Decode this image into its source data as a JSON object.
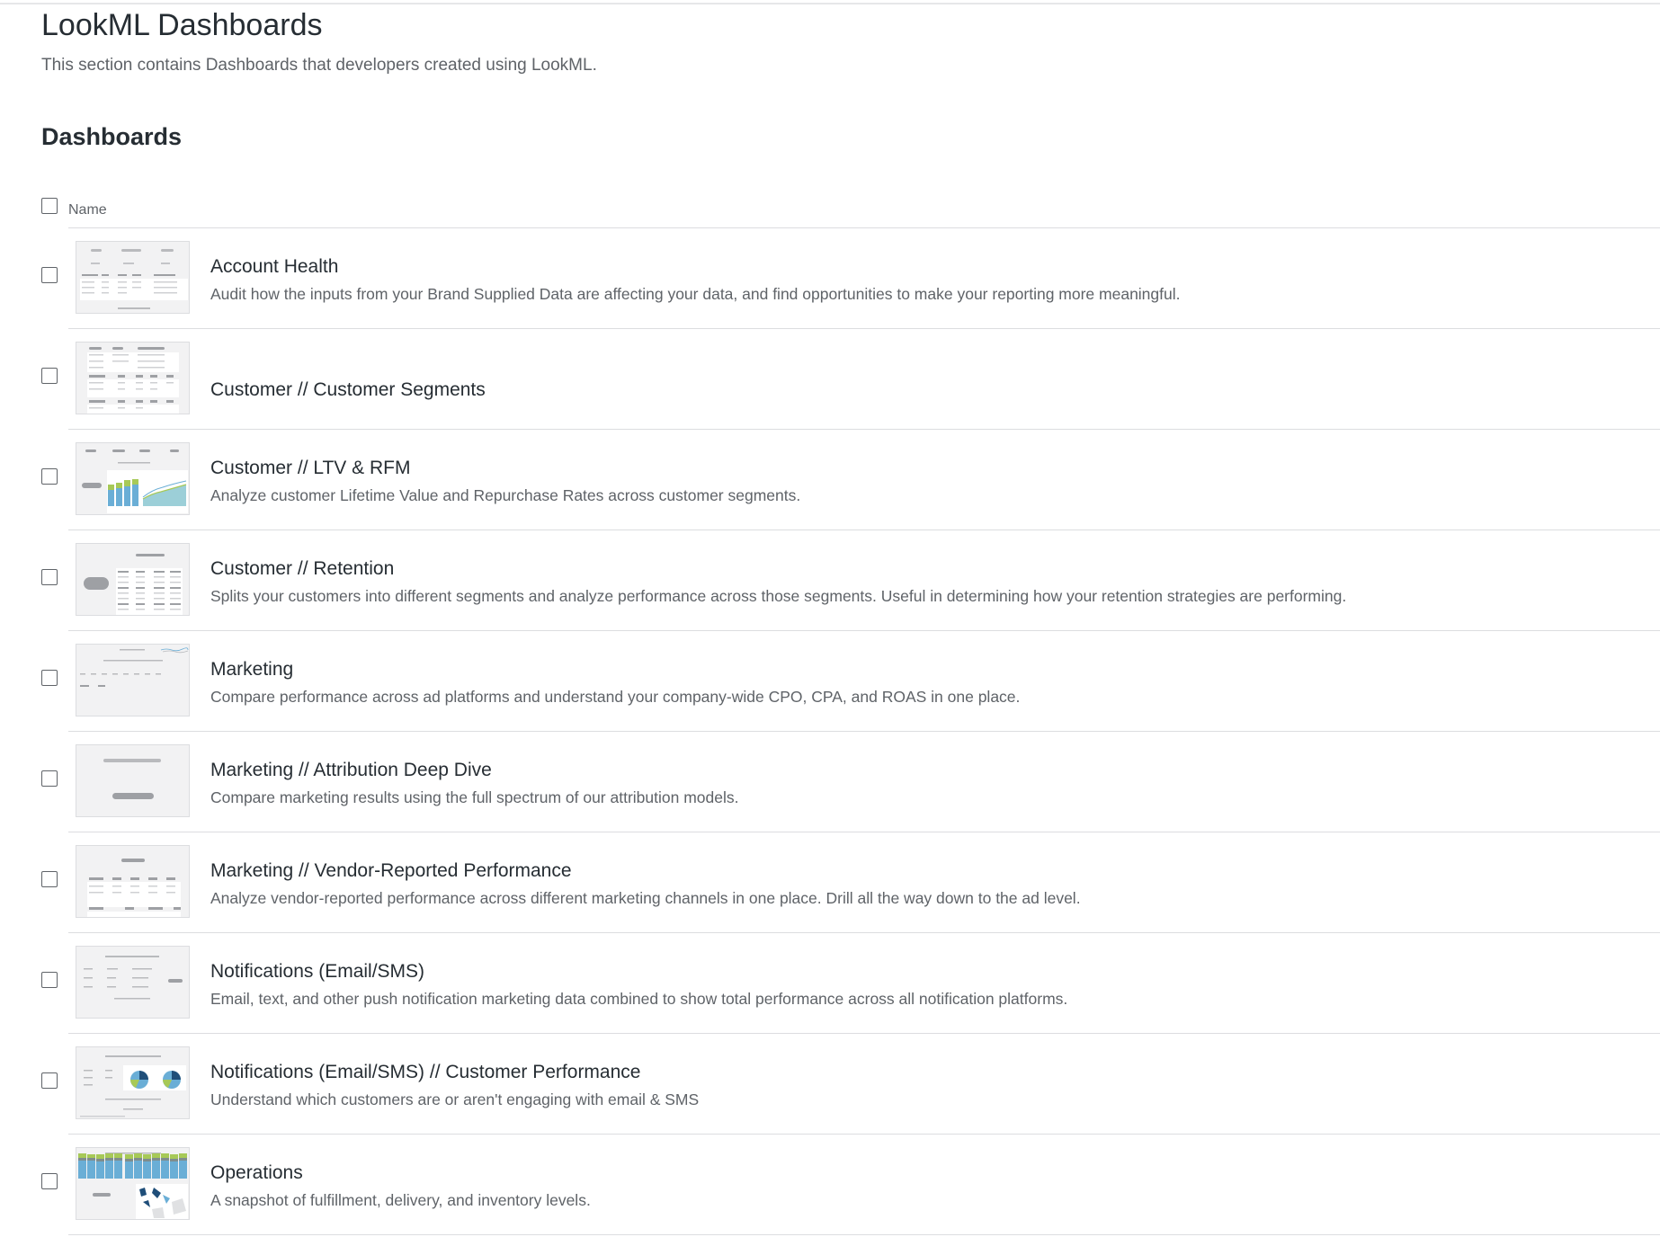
{
  "page": {
    "title": "LookML Dashboards",
    "subtitle": "This section contains Dashboards that developers created using LookML."
  },
  "section": {
    "title": "Dashboards",
    "column_name": "Name"
  },
  "dashboards": [
    {
      "title": "Account Health",
      "description": "Audit how the inputs from your Brand Supplied Data are affecting your data, and find opportunities to make your reporting more meaningful."
    },
    {
      "title": "Customer // Customer Segments",
      "description": ""
    },
    {
      "title": "Customer // LTV & RFM",
      "description": "Analyze customer Lifetime Value and Repurchase Rates across customer segments."
    },
    {
      "title": "Customer // Retention",
      "description": "Splits your customers into different segments and analyze performance across those segments. Useful in determining how your retention strategies are performing."
    },
    {
      "title": "Marketing",
      "description": "Compare performance across ad platforms and understand your company-wide CPO, CPA, and ROAS in one place."
    },
    {
      "title": "Marketing // Attribution Deep Dive",
      "description": "Compare marketing results using the full spectrum of our attribution models."
    },
    {
      "title": "Marketing // Vendor-Reported Performance",
      "description": "Analyze vendor-reported performance across different marketing channels in one place. Drill all the way down to the ad level."
    },
    {
      "title": "Notifications (Email/SMS)",
      "description": "Email, text, and other push notification marketing data combined to show total performance across all notification platforms."
    },
    {
      "title": "Notifications (Email/SMS) // Customer Performance",
      "description": "Understand which customers are or aren't engaging with email & SMS"
    },
    {
      "title": "Operations",
      "description": "A snapshot of fulfillment, delivery, and inventory levels."
    }
  ],
  "colors": {
    "text_primary": "#262d33",
    "text_secondary": "#5f6368",
    "divider": "#dcdde0",
    "thumb_bg": "#f2f2f3",
    "chart_blue": "#6aaed6",
    "chart_green": "#a7c957",
    "chart_teal": "#9ccfd8"
  }
}
